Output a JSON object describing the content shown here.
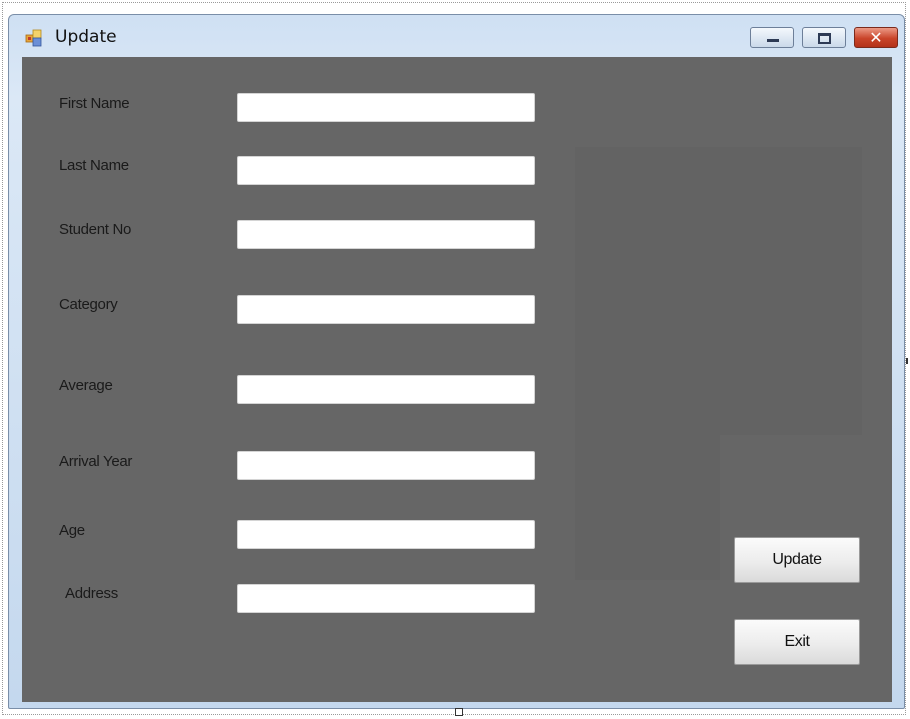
{
  "window": {
    "title": "Update",
    "icon": "windows-app-icon",
    "controls": {
      "minimize_icon": "minimize-icon",
      "maximize_icon": "maximize-icon",
      "close_icon": "close-icon",
      "close_glyph": "✕"
    }
  },
  "form": {
    "fields": [
      {
        "label": "First Name",
        "value": ""
      },
      {
        "label": "Last Name",
        "value": ""
      },
      {
        "label": "Student No",
        "value": ""
      },
      {
        "label": "Category",
        "value": ""
      },
      {
        "label": "Average",
        "value": ""
      },
      {
        "label": "Arrival Year",
        "value": ""
      },
      {
        "label": "Age",
        "value": ""
      },
      {
        "label": "Address",
        "value": ""
      }
    ],
    "update_button": "Update",
    "exit_button": "Exit"
  },
  "colors": {
    "client_background": "#666666",
    "titlebar": "#c4d8ee",
    "close_button": "#c9442a"
  }
}
